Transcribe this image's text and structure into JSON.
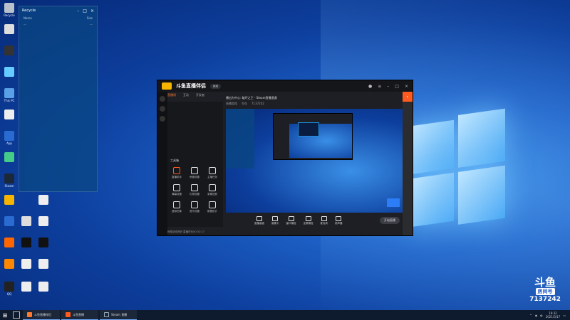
{
  "desktop": {
    "icons": [
      {
        "label": "Recycle",
        "color": "#b9c2cc"
      },
      {
        "label": "This PC",
        "color": "#5aa0e6"
      },
      {
        "label": "App",
        "color": "#2a6bd1"
      },
      {
        "label": "Steam",
        "color": "#1b2838"
      },
      {
        "label": "QQ",
        "color": "#222"
      }
    ]
  },
  "explorer": {
    "title": "Recycle",
    "col_left": "Name",
    "col_right": "Size"
  },
  "client": {
    "brand": "斗鱼直播伴侣",
    "version_pill": "MM",
    "tabs": [
      "直播间",
      "互动",
      "开发者"
    ],
    "stream_title": "播出为中心: 破坏之王 - Steam直播速通",
    "stream_sub": [
      "直播游戏",
      "生存",
      "7137242"
    ],
    "tools_title": "工具箱",
    "tools": [
      {
        "label": "直播助手",
        "pos": "r1c1"
      },
      {
        "label": "房管设置",
        "pos": "r1c2"
      },
      {
        "label": "主播任务",
        "pos": "r1c3"
      },
      {
        "label": "弹幕设置",
        "pos": "r2c1"
      },
      {
        "label": "礼物设置",
        "pos": "r2c2"
      },
      {
        "label": "录像回放",
        "pos": "r2c3"
      },
      {
        "label": "虚拟形象",
        "pos": "r3c1"
      },
      {
        "label": "音乐设置",
        "pos": "r3c2"
      },
      {
        "label": "数据统计",
        "pos": "r3c3"
      }
    ],
    "bottom_controls": [
      "直播画面",
      "摄像头",
      "窗口捕捉",
      "全屏捕捉",
      "麦克风",
      "扬声器"
    ],
    "go_live": "开始直播",
    "status": "网络状态良好 直播时长00:32:17"
  },
  "badge": {
    "logo": "斗鱼",
    "room_label": "房间号",
    "room_number": "7137242"
  },
  "taskbar": {
    "tasks": [
      {
        "label": "斗鱼直播伴侣",
        "color": "#ff7a2f"
      },
      {
        "label": "斗鱼直播",
        "color": "#ff5a1f"
      },
      {
        "label": "Steam 直播",
        "color": "#1b2838"
      }
    ],
    "time": "19:32",
    "date": "2021/3/17"
  }
}
